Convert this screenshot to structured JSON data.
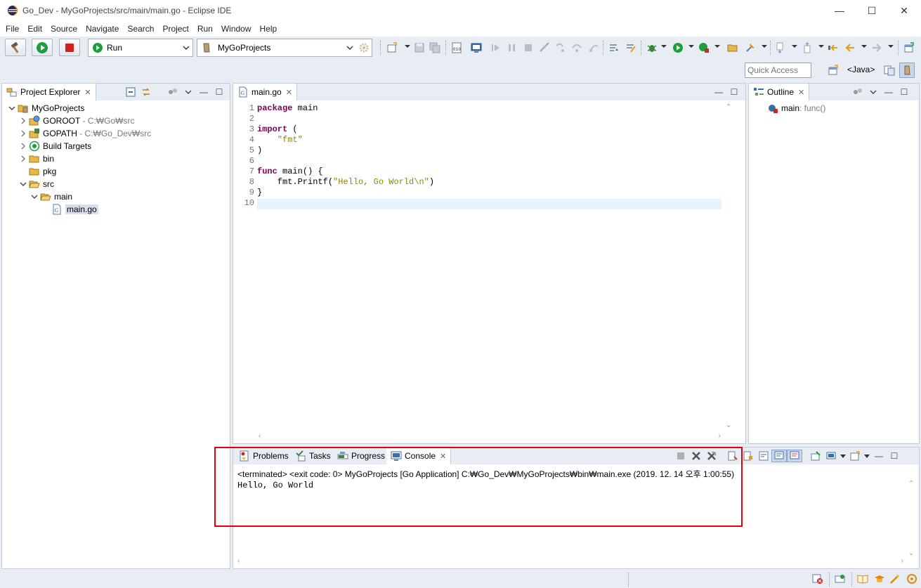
{
  "window": {
    "title": "Go_Dev - MyGoProjects/src/main/main.go - Eclipse IDE",
    "minimize": "—",
    "maximize": "☐",
    "close": "✕"
  },
  "menu": {
    "items": [
      "File",
      "Edit",
      "Source",
      "Navigate",
      "Search",
      "Project",
      "Run",
      "Window",
      "Help"
    ]
  },
  "toolbar": {
    "build_icon": "hammer-icon",
    "run_icon": "run-icon",
    "stop_icon": "stop-icon",
    "launch_mode": "Run",
    "launch_config": "MyGoProjects",
    "quick_access_placeholder": "Quick Access",
    "perspective_label": "<Java>",
    "active_perspective_icon": "debug-perspective-icon"
  },
  "project_explorer": {
    "tab_label": "Project Explorer",
    "tree": [
      {
        "name": "MyGoProjects",
        "suffix": "",
        "icon": "project-icon",
        "depth": 0,
        "expanded": true,
        "has_children": true,
        "selected": false
      },
      {
        "name": "GOROOT",
        "suffix": " - C:₩Go₩src",
        "icon": "goroot-icon",
        "depth": 1,
        "expanded": false,
        "has_children": true,
        "selected": false
      },
      {
        "name": "GOPATH",
        "suffix": " - C:₩Go_Dev₩src",
        "icon": "gopath-icon",
        "depth": 1,
        "expanded": false,
        "has_children": true,
        "selected": false
      },
      {
        "name": "Build Targets",
        "suffix": "",
        "icon": "build-target-icon",
        "depth": 1,
        "expanded": false,
        "has_children": true,
        "selected": false
      },
      {
        "name": "bin",
        "suffix": "",
        "icon": "folder-icon",
        "depth": 1,
        "expanded": false,
        "has_children": true,
        "selected": false
      },
      {
        "name": "pkg",
        "suffix": "",
        "icon": "folder-icon",
        "depth": 1,
        "expanded": false,
        "has_children": false,
        "selected": false
      },
      {
        "name": "src",
        "suffix": "",
        "icon": "folder-open-icon",
        "depth": 1,
        "expanded": true,
        "has_children": true,
        "selected": false
      },
      {
        "name": "main",
        "suffix": "",
        "icon": "folder-open-icon",
        "depth": 2,
        "expanded": true,
        "has_children": true,
        "selected": false
      },
      {
        "name": "main.go",
        "suffix": "",
        "icon": "go-file-icon",
        "depth": 3,
        "expanded": false,
        "has_children": false,
        "selected": true
      }
    ]
  },
  "editor": {
    "tab_label": "main.go",
    "current_line": 10,
    "lines": [
      [
        {
          "t": "package",
          "k": "kw"
        },
        {
          "t": " main",
          "k": "plain"
        }
      ],
      [],
      [
        {
          "t": "import",
          "k": "kw"
        },
        {
          "t": " (",
          "k": "plain"
        }
      ],
      [
        {
          "t": "    ",
          "k": "plain"
        },
        {
          "t": "\"fmt\"",
          "k": "str"
        }
      ],
      [
        {
          "t": ")",
          "k": "plain"
        }
      ],
      [],
      [
        {
          "t": "func",
          "k": "kw"
        },
        {
          "t": " main() {",
          "k": "plain"
        }
      ],
      [
        {
          "t": "    fmt.Printf(",
          "k": "plain"
        },
        {
          "t": "\"Hello, Go World\\n\"",
          "k": "str"
        },
        {
          "t": ")",
          "k": "plain"
        }
      ],
      [
        {
          "t": "}",
          "k": "plain"
        }
      ],
      []
    ]
  },
  "outline": {
    "tab_label": "Outline",
    "items": [
      {
        "name": "main",
        "suffix": " : func()",
        "icon": "function-icon"
      }
    ]
  },
  "console": {
    "tabs": [
      {
        "label": "Problems",
        "icon": "problems-icon",
        "active": false
      },
      {
        "label": "Tasks",
        "icon": "tasks-icon",
        "active": false
      },
      {
        "label": "Progress",
        "icon": "progress-icon",
        "active": false
      },
      {
        "label": "Console",
        "icon": "console-icon",
        "active": true
      }
    ],
    "status_line": "<terminated> <exit code: 0> MyGoProjects [Go Application] C:₩Go_Dev₩MyGoProjects₩bin₩main.exe (2019. 12. 14 오후 1:00:55)",
    "output_lines": [
      "Hello, Go World"
    ]
  },
  "colors": {
    "keyword": "#7f0055",
    "string": "#8a8a00",
    "annotation": "#e3000f",
    "run_green": "#1e9e3a",
    "stop_red": "#d81e1e",
    "folder_yellow": "#e8b84a",
    "selection": "#d6dfee"
  }
}
